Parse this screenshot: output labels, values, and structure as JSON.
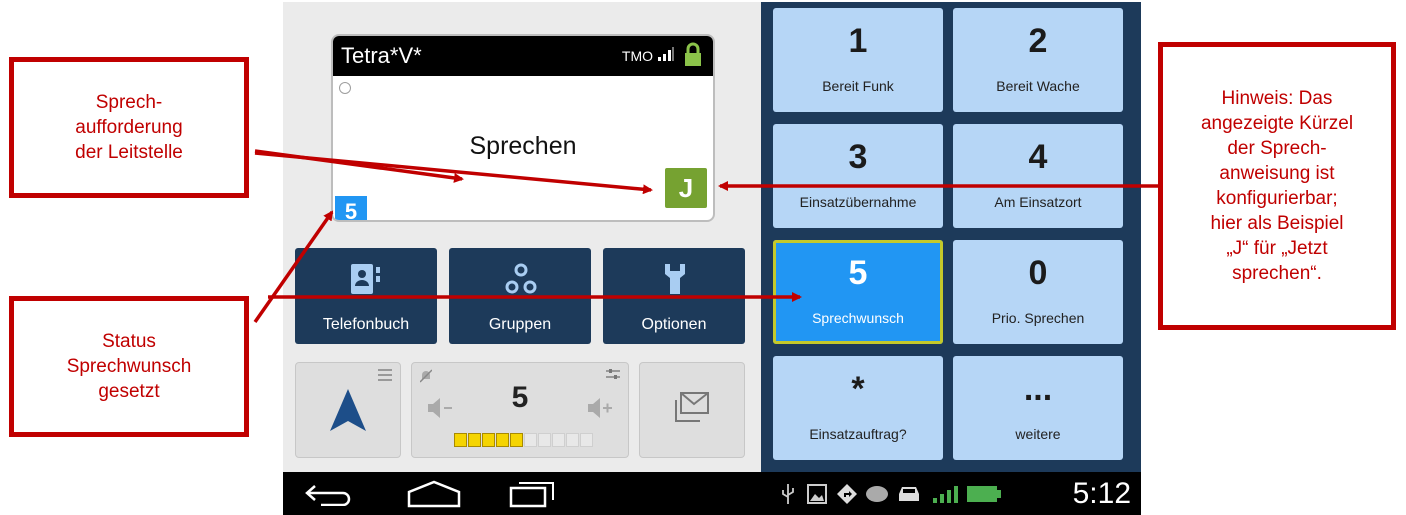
{
  "display": {
    "title": "Tetra*V*",
    "network": "TMO",
    "message": "Sprechen",
    "status_badge": "5",
    "speak_badge": "J"
  },
  "nav_buttons": [
    {
      "label": "Telefonbuch",
      "icon": "phonebook-icon"
    },
    {
      "label": "Gruppen",
      "icon": "groups-icon"
    },
    {
      "label": "Optionen",
      "icon": "wrench-icon"
    }
  ],
  "volume": {
    "value": "5",
    "level_fraction": 0.5
  },
  "keypad": [
    {
      "num": "1",
      "label": "Bereit Funk"
    },
    {
      "num": "2",
      "label": "Bereit Wache"
    },
    {
      "num": "3",
      "label": "Einsatzübernahme"
    },
    {
      "num": "4",
      "label": "Am Einsatzort"
    },
    {
      "num": "5",
      "label": "Sprechwunsch"
    },
    {
      "num": "0",
      "label": "Prio. Sprechen"
    },
    {
      "num": "*",
      "label": "Einsatzauftrag?"
    },
    {
      "num": "...",
      "label": "weitere"
    }
  ],
  "system_bar": {
    "time": "5:12"
  },
  "callouts": {
    "top_left": [
      "Sprech-",
      "aufforderung",
      "der Leitstelle"
    ],
    "bottom_left": [
      "Status",
      "Sprechwunsch",
      "gesetzt"
    ],
    "right": [
      "Hinweis: Das",
      "angezeigte Kürzel",
      "der Sprech-",
      "anweisung ist",
      "konfigurierbar;",
      "hier als Beispiel",
      "„J“ für „Jetzt",
      "sprechen“."
    ]
  },
  "colors": {
    "accent": "#2196f3",
    "speak": "#76a231",
    "callout": "#c00000",
    "panel": "#1d3a5a"
  }
}
